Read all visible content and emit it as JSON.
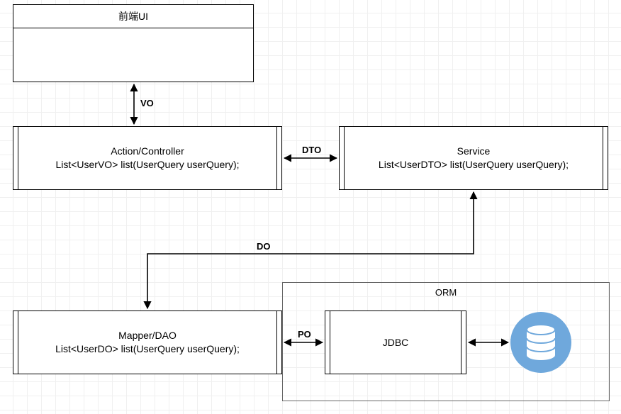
{
  "boxes": {
    "ui": {
      "title": "前端UI",
      "body": ""
    },
    "controller": {
      "title": "Action/Controller",
      "body": "List<UserVO> list(UserQuery userQuery);"
    },
    "service": {
      "title": "Service",
      "body": "List<UserDTO> list(UserQuery userQuery);"
    },
    "dao": {
      "title": "Mapper/DAO",
      "body": "List<UserDO> list(UserQuery userQuery);"
    },
    "jdbc": {
      "title": "JDBC",
      "body": ""
    },
    "orm": {
      "title": "ORM"
    }
  },
  "edges": {
    "ui_controller": {
      "label": "VO"
    },
    "controller_service": {
      "label": "DTO"
    },
    "service_dao": {
      "label": "DO"
    },
    "dao_jdbc": {
      "label": "PO"
    },
    "jdbc_db": {
      "label": ""
    }
  },
  "icons": {
    "database": "database-icon"
  }
}
